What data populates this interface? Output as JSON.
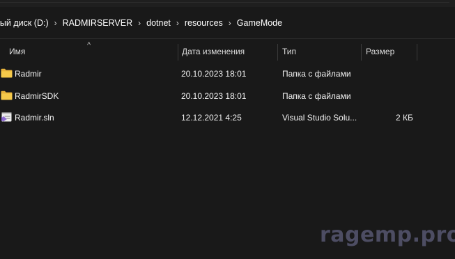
{
  "breadcrumb": {
    "items": [
      "ный диск (D:)",
      "RADMIRSERVER",
      "dotnet",
      "resources",
      "GameMode"
    ],
    "separator": "›"
  },
  "columns": {
    "name": "Имя",
    "date": "Дата изменения",
    "type": "Тип",
    "size": "Размер",
    "sort_indicator": "^"
  },
  "files": [
    {
      "name": "Radmir",
      "date": "20.10.2023 18:01",
      "type": "Папка с файлами",
      "size": "",
      "icon": "folder-icon"
    },
    {
      "name": "RadmirSDK",
      "date": "20.10.2023 18:01",
      "type": "Папка с файлами",
      "size": "",
      "icon": "folder-icon"
    },
    {
      "name": "Radmir.sln",
      "date": "12.12.2021 4:25",
      "type": "Visual Studio Solu...",
      "size": "2 КБ",
      "icon": "visual-studio-solution-icon"
    }
  ],
  "watermark": "ragemp.pro",
  "colors": {
    "background": "#191919",
    "folder": "#e8b33c",
    "vs_purple": "#7b5bbf",
    "watermark": "#4d4d63"
  }
}
